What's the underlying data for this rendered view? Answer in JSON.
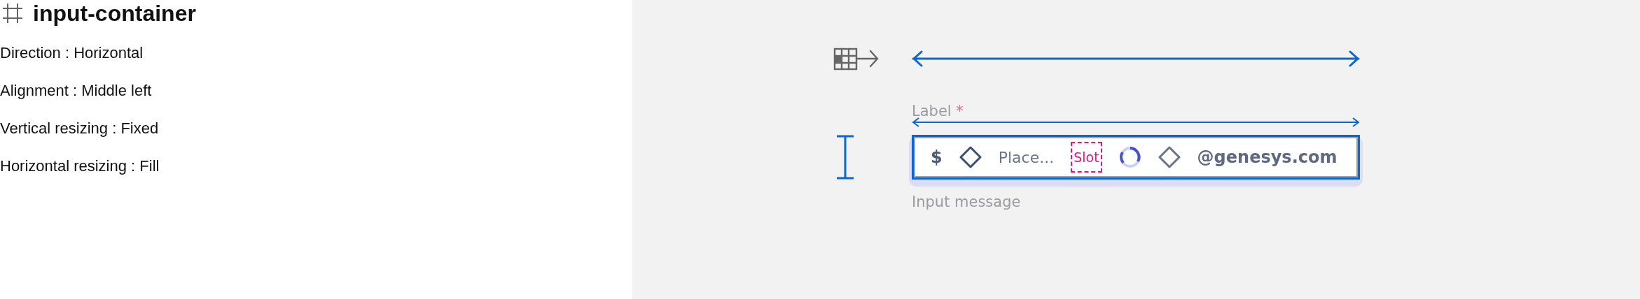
{
  "header": {
    "title": "input-container"
  },
  "properties": [
    "Direction : Horizontal",
    "Alignment : Middle left",
    "Vertical resizing : Fixed",
    "Horizontal resizing : Fill"
  ],
  "input": {
    "label": "Label",
    "required_mark": "*",
    "prefix": "$",
    "placeholder": "Place...",
    "slot": "Slot",
    "suffix": "@genesys.com",
    "message": "Input message"
  }
}
